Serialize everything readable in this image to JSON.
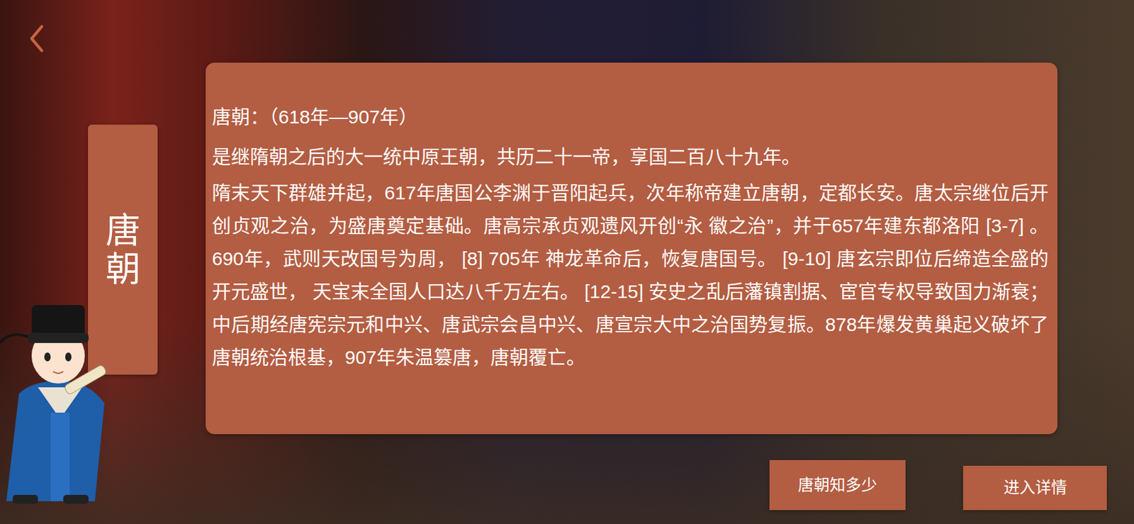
{
  "side_label": "唐朝",
  "panel": {
    "title": "唐朝：（618年—907年）",
    "summary": "是继隋朝之后的大一统中原王朝，共历二十一帝，享国二百八十九年。",
    "body": "隋末天下群雄并起，617年唐国公李渊于晋阳起兵，次年称帝建立唐朝，定都长安。唐太宗继位后开创贞观之治，为盛唐奠定基础。唐高宗承贞观遗风开创“永 徽之治”，并于657年建东都洛阳 [3-7] 。690年，武则天改国号为周， [8] 705年 神龙革命后，恢复唐国号。 [9-10] 唐玄宗即位后缔造全盛的开元盛世， 天宝末全国人口达八千万左右。 [12-15] 安史之乱后藩镇割据、宦官专权导致国力渐衰；中后期经唐宪宗元和中兴、唐武宗会昌中兴、唐宣宗大中之治国势复振。878年爆发黄巢起义破坏了唐朝统治根基，907年朱温篡唐，唐朝覆亡。"
  },
  "buttons": [
    "唐朝知多少",
    "进入详情"
  ]
}
